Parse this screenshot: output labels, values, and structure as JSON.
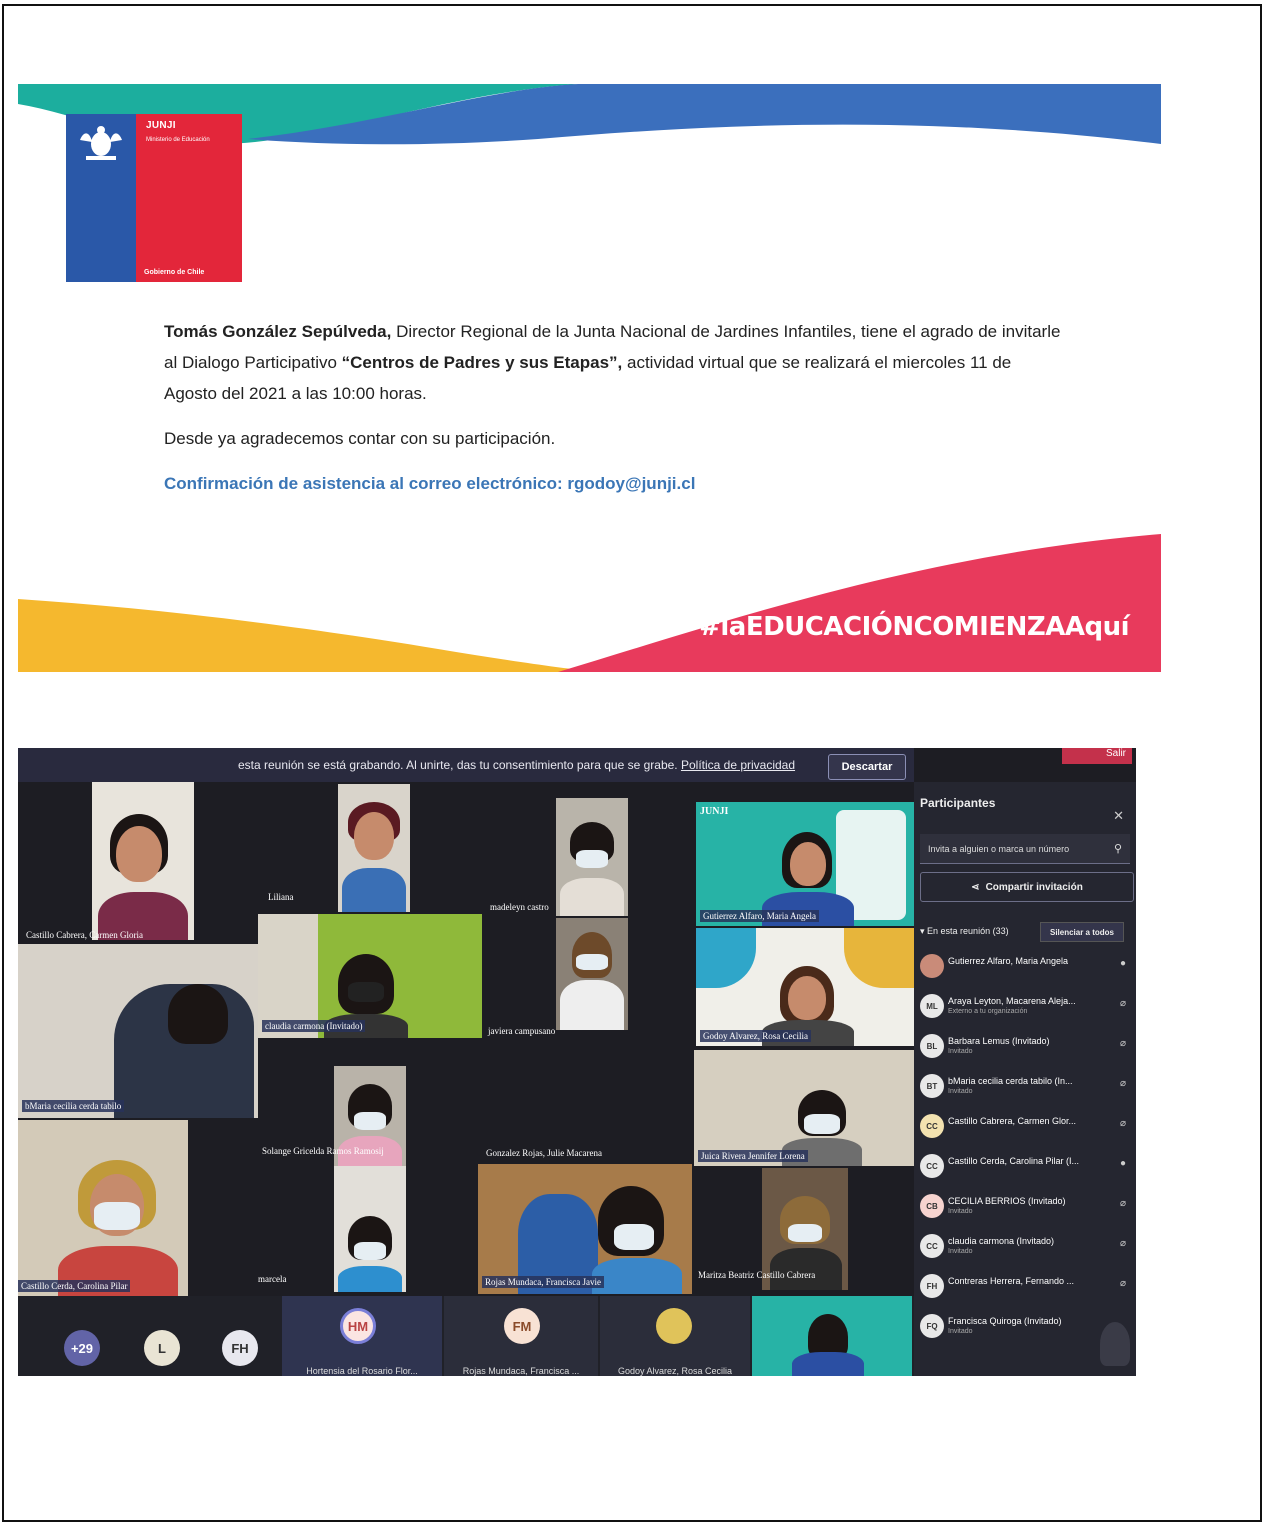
{
  "invite": {
    "logo": {
      "org": "JUNJI",
      "ministry": "Ministerio de Educación",
      "government": "Gobierno de Chile"
    },
    "sender_name": "Tomás González Sepúlveda,",
    "p1_a": " Director Regional de la Junta Nacional de Jardines Infantiles, tiene el agrado de invitarle al Dialogo Participativo ",
    "event_title": "“Centros de Padres y sus Etapas”,",
    "p1_b": " actividad virtual que se realizará el miercoles 11 de Agosto del 2021 a las 10:00 horas.",
    "p2": "Desde ya agradecemos contar con su participación.",
    "confirm": "Confirmación de asistencia al correo electrónico: rgodoy@junji.cl",
    "hashtag": "#laEDUCACIÓNCOMIENZAAquí",
    "colors": {
      "teal": "#1cae9e",
      "blue": "#3b6fbd",
      "yellow": "#f5b82e",
      "pink": "#e83a5c"
    }
  },
  "meeting": {
    "banner_text": "esta reunión se está grabando. Al unirte, das tu consentimiento para que se grabe. ",
    "banner_link": "Política de privacidad",
    "dismiss_label": "Descartar",
    "leave_label": "Salir",
    "tiles": [
      {
        "name": "Castillo Cabrera, Carmen Gloria"
      },
      {
        "name": "Liliana"
      },
      {
        "name": "madeleyn castro"
      },
      {
        "name": "Gutierrez Alfaro, Maria Angela"
      },
      {
        "name": "claudia carmona (Invitado)"
      },
      {
        "name": "javiera campusano"
      },
      {
        "name": "Godoy Alvarez, Rosa Cecilia"
      },
      {
        "name": "bMaria cecilia cerda tabilo"
      },
      {
        "name": "Solange Gricelda Ramos Ramosij"
      },
      {
        "name": "Gonzalez Rojas, Julie Macarena"
      },
      {
        "name": "Juica Rivera Jennifer Lorena"
      },
      {
        "name": "Castillo Cerda, Carolina Pilar"
      },
      {
        "name": "marcela"
      },
      {
        "name": "Rojas Mundaca, Francisca Javie"
      },
      {
        "name": "Maritza Beatriz Castillo Cabrera"
      }
    ],
    "tile_brand": "JUNJI",
    "bottom": {
      "more": "+29",
      "l": "L",
      "fh": "FH",
      "hm": "HM",
      "hm_name": "Hortensia del Rosario Flor...",
      "fm": "FM",
      "fm_name": "Rojas Mundaca, Francisca ...",
      "godoy_name": "Godoy Alvarez, Rosa Cecilia"
    },
    "panel": {
      "title": "Participantes",
      "search_placeholder": "Invita a alguien o marca un número",
      "share_label": "Compartir invitación",
      "in_meeting": "En esta reunión (33)",
      "mute_all": "Silenciar a todos",
      "participants": [
        {
          "initials": "",
          "name": "Gutierrez Alfaro, Maria Angela",
          "sub": ""
        },
        {
          "initials": "ML",
          "name": "Araya Leyton, Macarena Aleja...",
          "sub": "Externo a tu organización"
        },
        {
          "initials": "BL",
          "name": "Barbara Lemus (Invitado)",
          "sub": "Invitado"
        },
        {
          "initials": "BT",
          "name": "bMaria cecilia cerda tabilo (In...",
          "sub": "Invitado"
        },
        {
          "initials": "CC",
          "name": "Castillo Cabrera, Carmen Glor...",
          "sub": ""
        },
        {
          "initials": "CC",
          "name": "Castillo Cerda, Carolina Pilar (I...",
          "sub": ""
        },
        {
          "initials": "CB",
          "name": "CECILIA BERRIOS (Invitado)",
          "sub": "Invitado"
        },
        {
          "initials": "CC",
          "name": "claudia carmona (Invitado)",
          "sub": "Invitado"
        },
        {
          "initials": "FH",
          "name": "Contreras Herrera, Fernando ...",
          "sub": ""
        },
        {
          "initials": "FQ",
          "name": "Francisca Quiroga (Invitado)",
          "sub": "Invitado"
        }
      ]
    }
  }
}
